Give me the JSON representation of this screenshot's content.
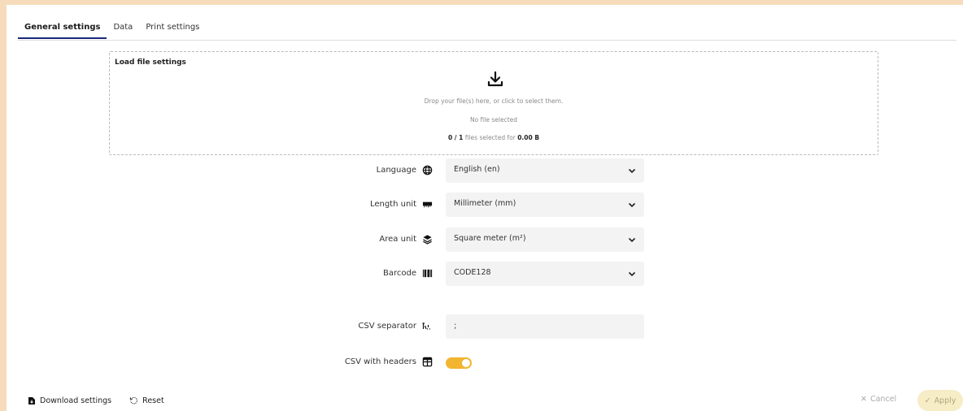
{
  "tabs": [
    {
      "label": "General settings",
      "active": true
    },
    {
      "label": "Data",
      "active": false
    },
    {
      "label": "Print settings",
      "active": false
    }
  ],
  "dropzone": {
    "title": "Load file settings",
    "icon": "download-icon",
    "instruction": "Drop your file(s) here, or click to select them.",
    "status": "No file selected",
    "count_prefix": "0 / 1",
    "count_middle": " files selected for ",
    "count_size": "0.00 B"
  },
  "fields": {
    "language": {
      "label": "Language",
      "icon": "globe-icon",
      "value": "English (en)"
    },
    "length_unit": {
      "label": "Length unit",
      "icon": "ruler-icon",
      "value": "Millimeter (mm)"
    },
    "area_unit": {
      "label": "Area unit",
      "icon": "layers-icon",
      "value": "Square meter (m²)"
    },
    "barcode": {
      "label": "Barcode",
      "icon": "barcode-icon",
      "value": "CODE128"
    },
    "csv_separator": {
      "label": "CSV separator",
      "icon": "separator-icon",
      "value": ";"
    },
    "csv_headers": {
      "label": "CSV with headers",
      "icon": "table-icon",
      "enabled": true
    }
  },
  "footer": {
    "download_label": "Download settings",
    "reset_label": "Reset",
    "cancel_label": "Cancel",
    "apply_label": "Apply"
  },
  "colors": {
    "accent": "#f2b530",
    "tab_underline": "#1a2a7a",
    "frame": "#f6dcbc",
    "apply_bg": "#f6ecc6"
  }
}
